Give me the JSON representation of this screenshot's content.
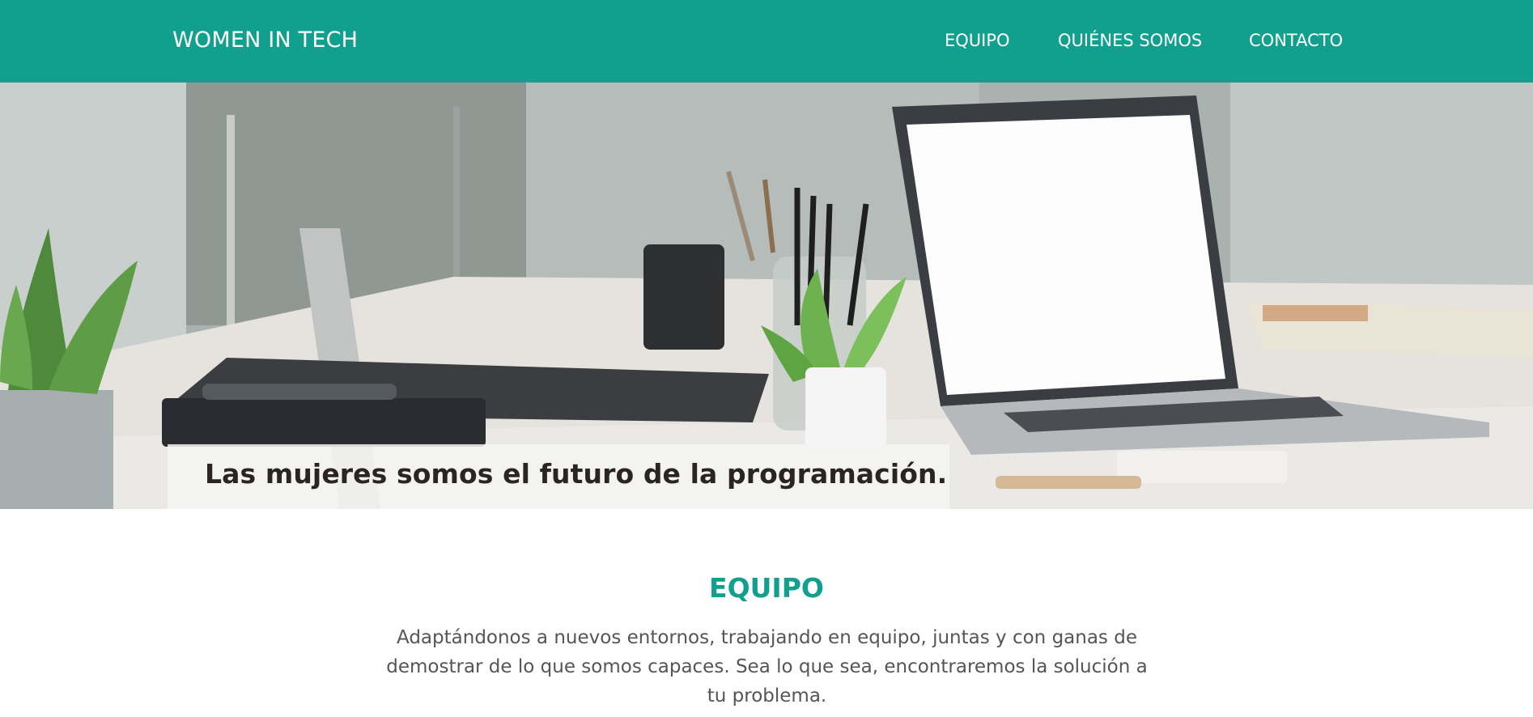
{
  "header": {
    "brand": "WOMEN IN TECH",
    "nav": [
      "EQUIPO",
      "QUIÉNES SOMOS",
      "CONTACTO"
    ],
    "background_color": "#12a08e"
  },
  "hero": {
    "caption": "Las mujeres somos el futuro de la programación."
  },
  "section": {
    "title": "EQUIPO",
    "text": "Adaptándonos a nuevos entornos, trabajando en equipo, juntas y con ganas de demostrar de lo que somos capaces. Sea lo que sea, encontraremos la solución a tu problema.",
    "accent_color": "#12a08e"
  }
}
